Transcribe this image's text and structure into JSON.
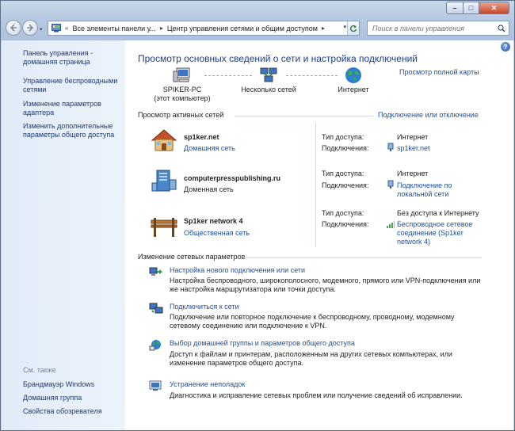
{
  "window": {
    "controls": {
      "minimize": "–",
      "maximize": "□",
      "close": "✕"
    }
  },
  "navigation": {
    "back_icon": "back-arrow-icon",
    "forward_icon": "forward-arrow-icon",
    "breadcrumb_sep": "«",
    "breadcrumbs": [
      "Все элементы панели у...",
      "Центр управления сетями и общим доступом"
    ],
    "crumb_arrow": "▸",
    "search_placeholder": "Поиск в панели управления"
  },
  "sidebar": {
    "links": [
      "Панель управления - домашняя страница",
      "Управление беспроводными сетями",
      "Изменение параметров адаптера",
      "Изменить дополнительные параметры общего доступа"
    ],
    "see_also_label": "См. также",
    "see_also": [
      "Брандмауэр Windows",
      "Домашняя группа",
      "Свойства обозревателя"
    ]
  },
  "main": {
    "title": "Просмотр основных сведений о сети и настройка подключений",
    "full_map_link": "Просмотр полной карты",
    "map": {
      "computer": {
        "name": "SPIKER-PC",
        "sub": "(этот компьютер)"
      },
      "networks": "Несколько сетей",
      "internet": "Интернет"
    },
    "active_section": "Просмотр активных сетей",
    "connect_link": "Подключение или отключение",
    "access_label": "Тип доступа:",
    "connections_label": "Подключения:",
    "networks": [
      {
        "name": "sp1ker.net",
        "type": "Домашняя сеть",
        "access": "Интернет",
        "connection": "sp1ker.net"
      },
      {
        "name": "computerpresspublishing.ru",
        "type": "Доменная сеть",
        "access": "Интернет",
        "connection": "Подключение по локальной сети"
      },
      {
        "name": "Sp1ker network 4",
        "type": "Общественная сеть",
        "access": "Без доступа к Интернету",
        "connection": "Беспроводное сетевое соединение (Sp1ker network 4)"
      }
    ],
    "change_section": "Изменение сетевых параметров",
    "tasks": [
      {
        "link": "Настройка нового подключения или сети",
        "desc": "Настройка беспроводного, широкополосного, модемного, прямого или VPN-подключения или же настройка маршрутизатора или точки доступа."
      },
      {
        "link": "Подключиться к сети",
        "desc": "Подключение или повторное подключение к беспроводному, проводному, модемному сетевому соединению или подключение к VPN."
      },
      {
        "link": "Выбор домашней группы и параметров общего доступа",
        "desc": "Доступ к файлам и принтерам, расположенным на других сетевых компьютерах, или изменение параметров общего доступа."
      },
      {
        "link": "Устранение неполадок",
        "desc": "Диагностика и исправление сетевых проблем или получение сведений об исправлении."
      }
    ]
  }
}
